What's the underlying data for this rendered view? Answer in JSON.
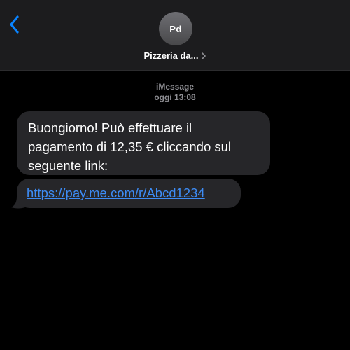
{
  "header": {
    "avatar_initials": "Pd",
    "contact_name": "Pizzeria da...",
    "colors": {
      "back": "#0a84ff",
      "background": "#1c1c1e"
    },
    "icons": {
      "back": "chevron-left-icon",
      "details": "chevron-right-icon"
    }
  },
  "thread": {
    "service": "iMessage",
    "timestamp": "oggi 13:08"
  },
  "messages": [
    {
      "text": "Buongiorno! Può effettuare il pagamento di 12,35 € cliccando sul seguente link:"
    },
    {
      "link": "https://pay.me.com/r/Abcd1234"
    }
  ],
  "colors": {
    "bubble": "#262629",
    "link": "#3d8cf5",
    "meta": "#8e8e93"
  }
}
